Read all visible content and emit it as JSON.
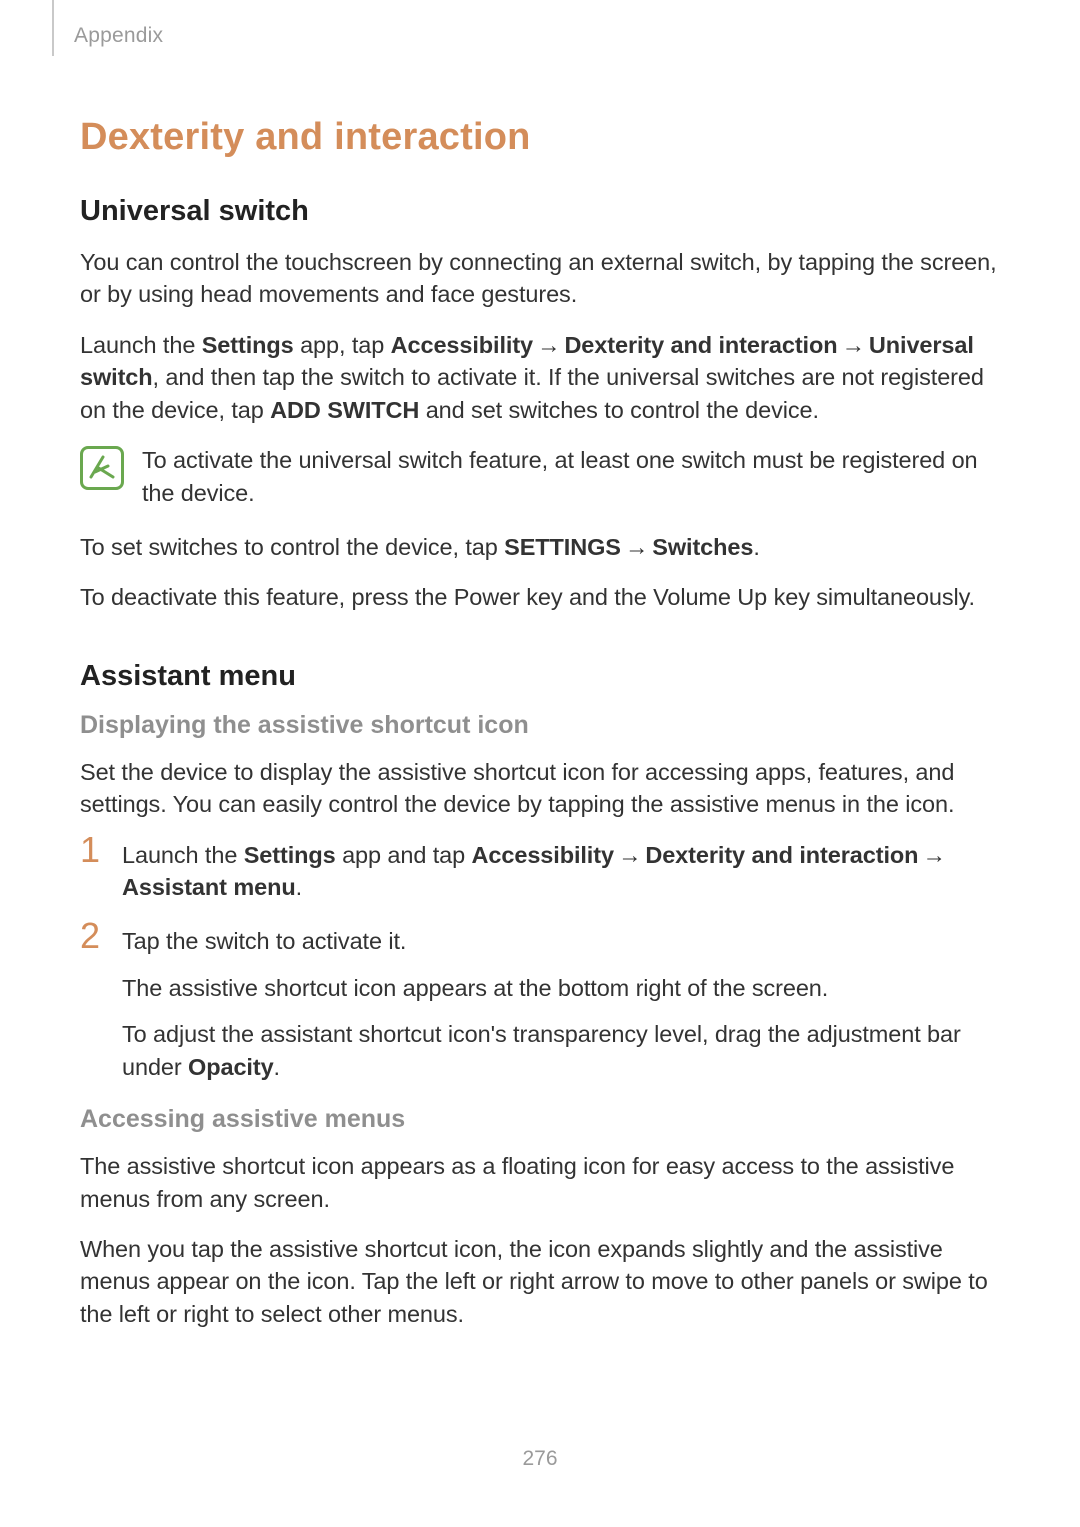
{
  "header": {
    "section": "Appendix"
  },
  "title": "Dexterity and interaction",
  "universal_switch": {
    "heading": "Universal switch",
    "p1": "You can control the touchscreen by connecting an external switch, by tapping the screen, or by using head movements and face gestures.",
    "p2a": "Launch the ",
    "p2_settings": "Settings",
    "p2b": " app, tap ",
    "p2_access": "Accessibility",
    "p2_dex": "Dexterity and interaction",
    "p2_uni": "Universal switch",
    "p2c": ", and then tap the switch to activate it. If the universal switches are not registered on the device, tap ",
    "p2_add": "ADD SWITCH",
    "p2d": " and set switches to control the device.",
    "note": "To activate the universal switch feature, at least one switch must be registered on the device.",
    "p3a": "To set switches to control the device, tap ",
    "p3_settings": "SETTINGS",
    "p3_switches": "Switches",
    "p3b": ".",
    "p4": "To deactivate this feature, press the Power key and the Volume Up key simultaneously."
  },
  "assistant_menu": {
    "heading": "Assistant menu",
    "sub1": "Displaying the assistive shortcut icon",
    "p1": "Set the device to display the assistive shortcut icon for accessing apps, features, and settings. You can easily control the device by tapping the assistive menus in the icon.",
    "step1a": "Launch the ",
    "step1_settings": "Settings",
    "step1b": " app and tap ",
    "step1_access": "Accessibility",
    "step1_dex": "Dexterity and interaction",
    "step1_assist": "Assistant menu",
    "step1c": ".",
    "step2a": "Tap the switch to activate it.",
    "step2b": "The assistive shortcut icon appears at the bottom right of the screen.",
    "step2c_a": "To adjust the assistant shortcut icon's transparency level, drag the adjustment bar under ",
    "step2c_opacity": "Opacity",
    "step2c_b": ".",
    "sub2": "Accessing assistive menus",
    "p2": "The assistive shortcut icon appears as a floating icon for easy access to the assistive menus from any screen.",
    "p3": "When you tap the assistive shortcut icon, the icon expands slightly and the assistive menus appear on the icon. Tap the left or right arrow to move to other panels or swipe to the left or right to select other menus."
  },
  "arrow": "→",
  "page_number": "276"
}
